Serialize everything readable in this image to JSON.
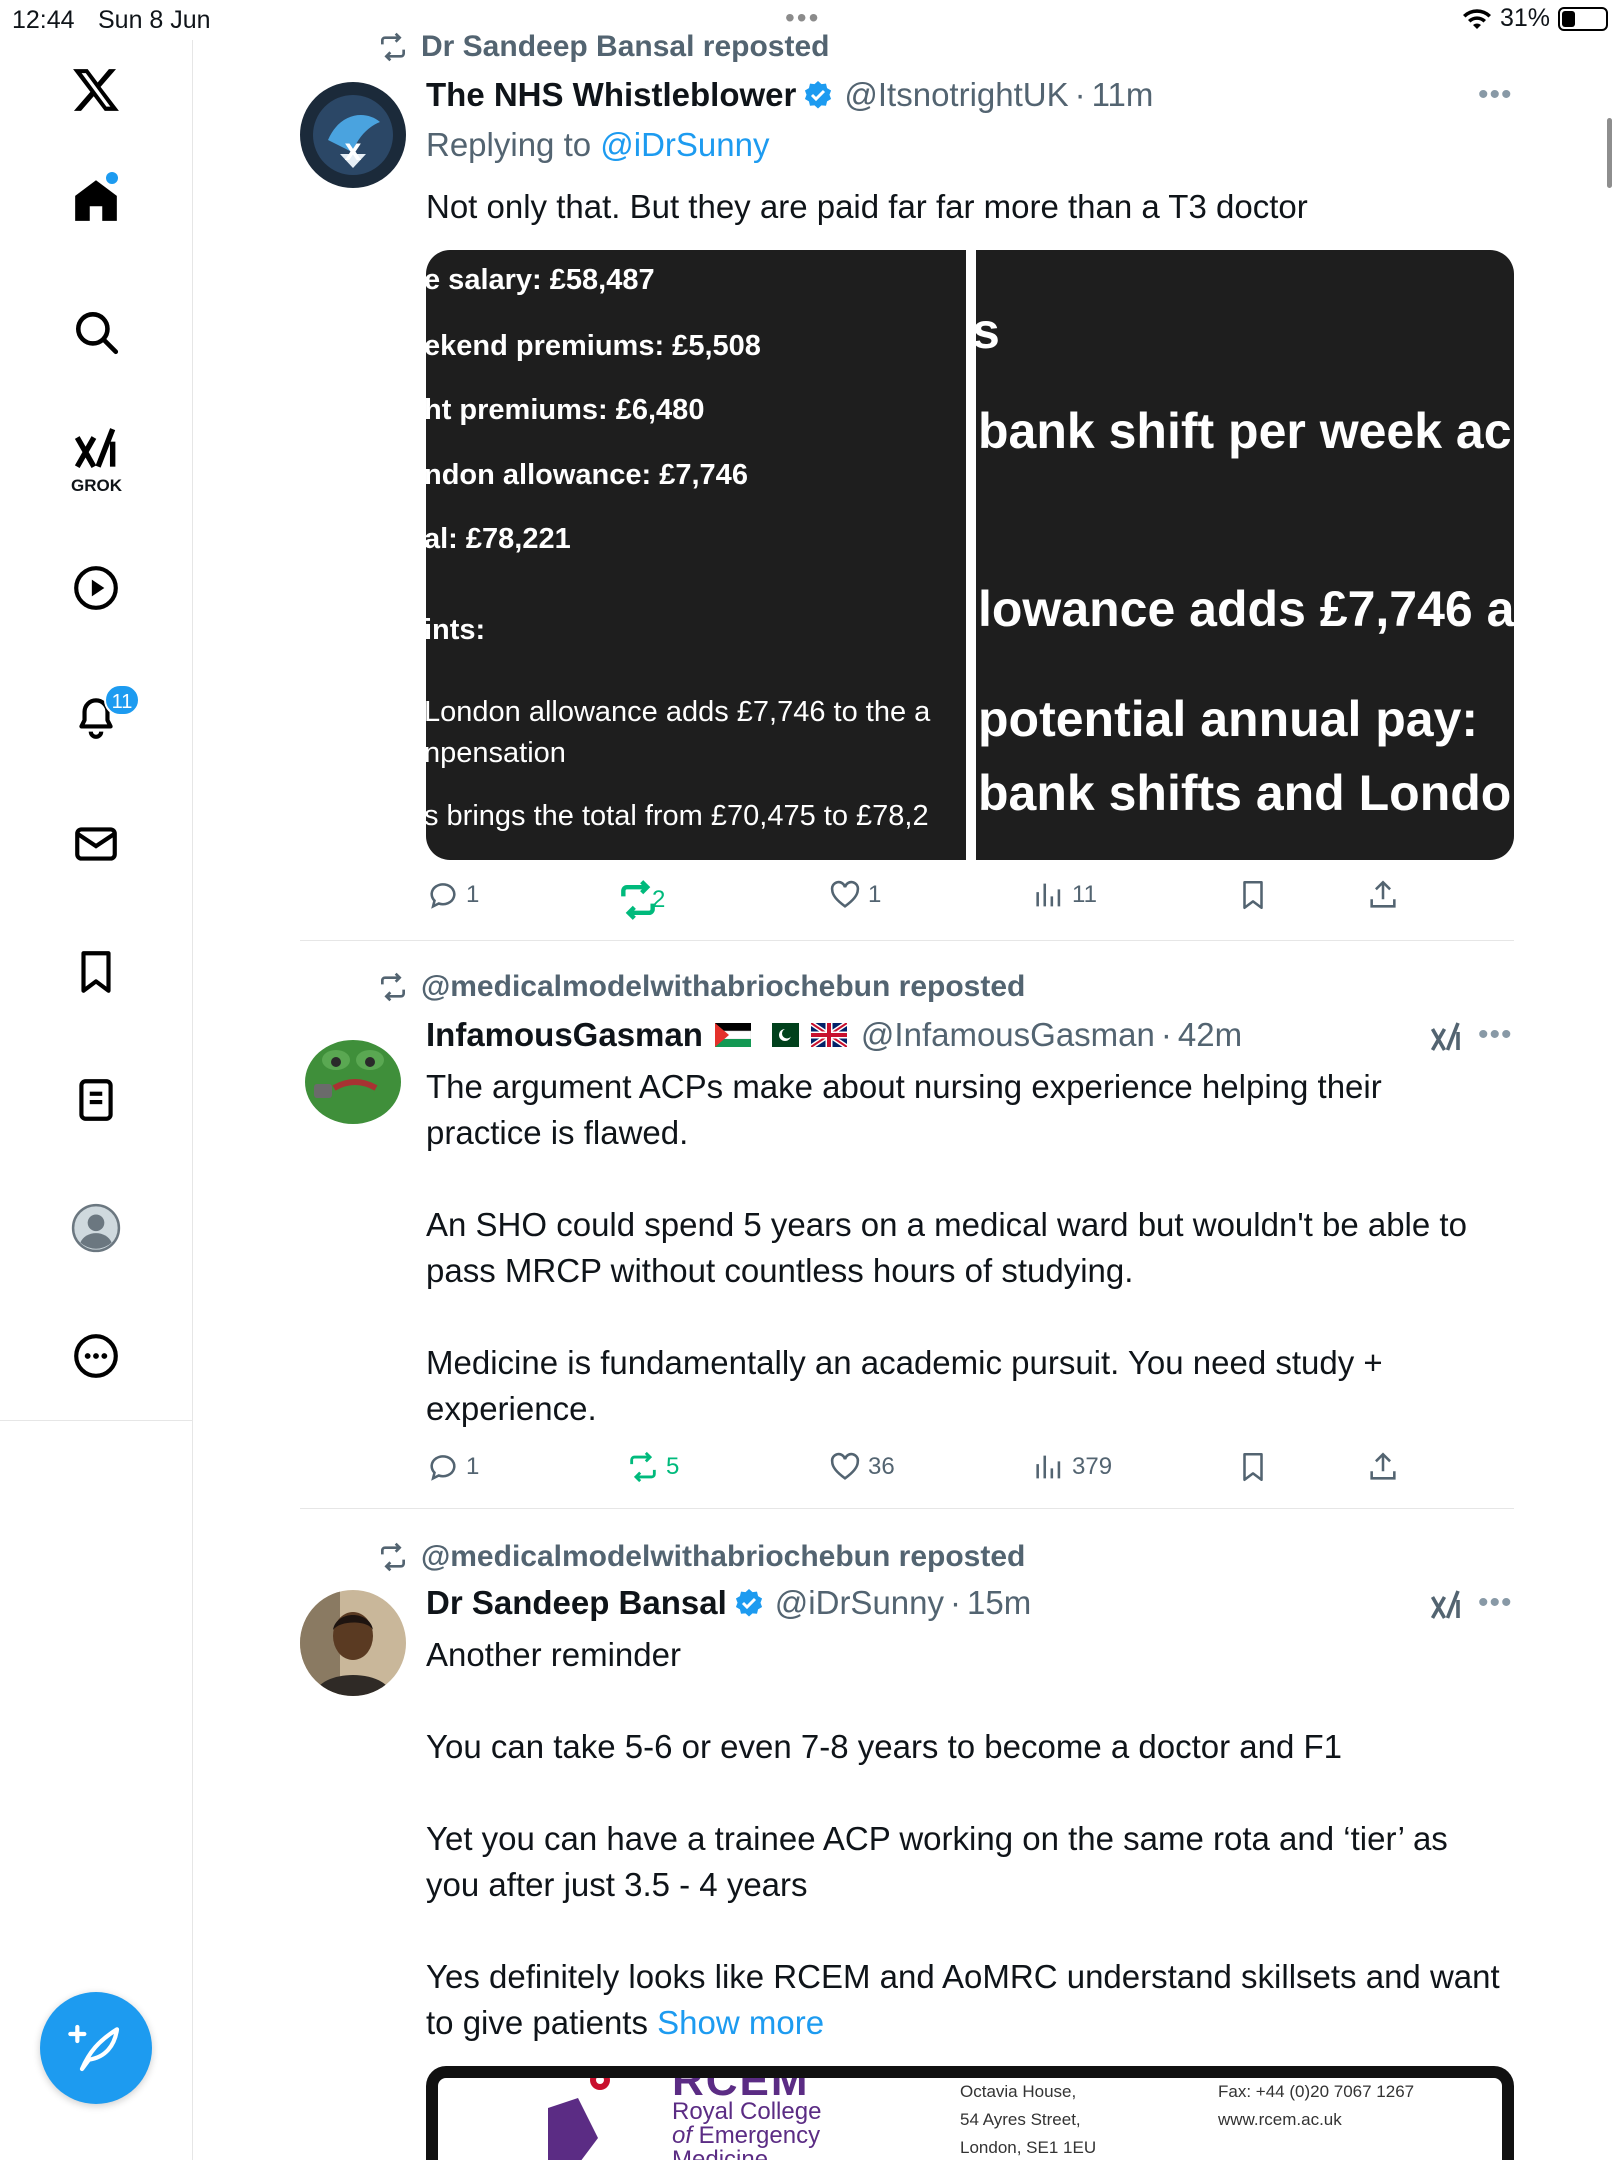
{
  "status": {
    "time": "12:44",
    "date": "Sun 8 Jun",
    "battery": "31%",
    "battery_fraction": 0.31
  },
  "sidebar": {
    "grok_label": "GROK",
    "notifications_count": "11"
  },
  "posts": [
    {
      "repost_label": "Dr Sandeep Bansal reposted",
      "author": "The NHS Whistleblower",
      "handle": "@ItsnotrightUK",
      "time": "11m",
      "replying_prefix": "Replying to ",
      "replying_handle": "@iDrSunny",
      "text": "Not only that. But they are paid far far more than a T3 doctor",
      "media_left": [
        "e salary: £58,487",
        "ekend premiums: £5,508",
        "ht premiums: £6,480",
        "ndon allowance: £7,746",
        "al: £78,221",
        "ints:",
        "London allowance adds £7,746 to the a",
        "npensation",
        "s brings the total from £70,475 to £78,2"
      ],
      "media_right": [
        "s",
        "bank shift per week ac",
        "lowance adds £7,746 a",
        "potential annual pay: ",
        "bank shifts and London"
      ],
      "replies": "1",
      "reposts": "2",
      "likes": "1",
      "views": "11"
    },
    {
      "repost_label": "@medicalmodelwithabriochebun reposted",
      "author": "InfamousGasman",
      "handle": "@InfamousGasman",
      "time": "42m",
      "paragraphs": [
        "The argument ACPs make about nursing experience helping their practice is flawed.",
        "An SHO could spend 5 years on a medical ward but wouldn't be able to pass MRCP without countless hours of studying.",
        "Medicine is fundamentally an academic pursuit. You need study + experience."
      ],
      "replies": "1",
      "reposts": "5",
      "likes": "36",
      "views": "379"
    },
    {
      "repost_label": "@medicalmodelwithabriochebun reposted",
      "author": "Dr Sandeep Bansal",
      "handle": "@iDrSunny",
      "time": "15m",
      "paragraphs": [
        "Another reminder",
        "You can take 5-6 or even 7-8 years to become a doctor and F1",
        "Yet you can have a trainee ACP working on the same rota and ‘tier’ as you after just 3.5 - 4 years",
        "Yes definitely looks like RCEM and AoMRC understand skillsets and want to give patients"
      ],
      "show_more": "Show more",
      "card": {
        "logo_text": "RCEM",
        "org_line1": "Royal College",
        "org_line2_prefix": "of",
        "org_line2_rest": " Emergency",
        "org_line3": "Medicine",
        "address": [
          "Octavia House,",
          "54 Ayres Street,",
          "London, SE1 1EU"
        ],
        "fax": "Fax: +44 (0)20 7067 1267",
        "web": "www.rcem.ac.uk"
      }
    }
  ],
  "colors": {
    "accent": "#1d9bf0",
    "repost_green": "#00ba7c",
    "muted": "#536471"
  }
}
